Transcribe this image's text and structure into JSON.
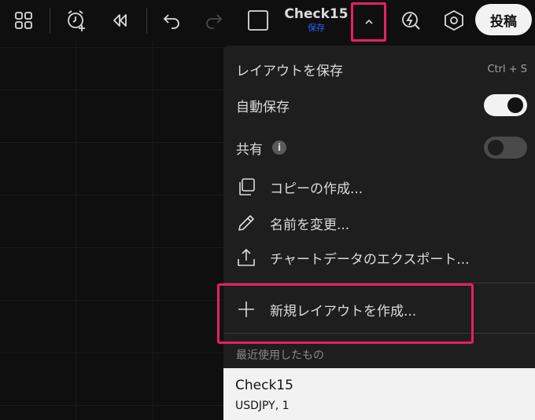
{
  "toolbar": {
    "layout_title": "Check15",
    "layout_status": "保存",
    "publish_label": "投稿"
  },
  "menu": {
    "save_layout": {
      "label": "レイアウトを保存",
      "shortcut": "Ctrl + S"
    },
    "autosave": {
      "label": "自動保存",
      "enabled": true
    },
    "share": {
      "label": "共有",
      "info_glyph": "i",
      "enabled": false
    },
    "copy": {
      "label": "コピーの作成..."
    },
    "rename": {
      "label": "名前を変更..."
    },
    "export": {
      "label": "チャートデータのエクスポート..."
    },
    "new_layout": {
      "label": "新規レイアウトを作成..."
    },
    "recent_section": "最近使用したもの",
    "recent_items": [
      {
        "title": "Check15",
        "subtitle": "USDJPY, 1"
      }
    ]
  },
  "colors": {
    "accent": "#2962ff",
    "highlight": "#e91e63",
    "menu_bg": "#1e1e1e",
    "page_bg": "#0f0f0f"
  },
  "icons": [
    "grid-layout-icon",
    "alert-clock-icon",
    "replay-icon",
    "undo-icon",
    "redo-icon",
    "layout-square-icon",
    "chevron-up-icon",
    "lightning-icon",
    "settings-hexagon-icon",
    "copy-icon",
    "pencil-icon",
    "upload-icon",
    "plus-icon",
    "info-icon"
  ]
}
